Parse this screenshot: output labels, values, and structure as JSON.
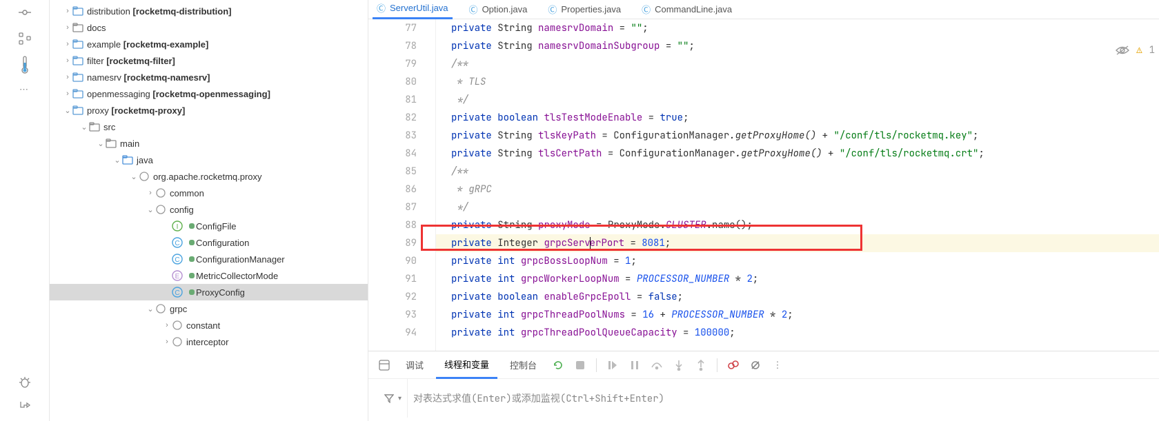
{
  "tree": {
    "n0": "distribution",
    "n0b": "[rocketmq-distribution]",
    "n1": "docs",
    "n2": "example",
    "n2b": "[rocketmq-example]",
    "n3": "filter",
    "n3b": "[rocketmq-filter]",
    "n4": "namesrv",
    "n4b": "[rocketmq-namesrv]",
    "n5": "openmessaging",
    "n5b": "[rocketmq-openmessaging]",
    "n6": "proxy",
    "n6b": "[rocketmq-proxy]",
    "n7": "src",
    "n8": "main",
    "n9": "java",
    "n10": "org.apache.rocketmq.proxy",
    "n11": "common",
    "n12": "config",
    "n13": "ConfigFile",
    "n14": "Configuration",
    "n15": "ConfigurationManager",
    "n16": "MetricCollectorMode",
    "n17": "ProxyConfig",
    "n18": "grpc",
    "n19": "constant",
    "n20": "interceptor"
  },
  "tabs": {
    "t0": "ServerUtil.java",
    "t1": "Option.java",
    "t2": "Properties.java",
    "t3": "CommandLine.java"
  },
  "lines": {
    "n77": "77",
    "n78": "78",
    "n79": "79",
    "n80": "80",
    "n81": "81",
    "n82": "82",
    "n83": "83",
    "n84": "84",
    "n85": "85",
    "n86": "86",
    "n87": "87",
    "n88": "88",
    "n89": "89",
    "n90": "90",
    "n91": "91",
    "n92": "92",
    "n93": "93",
    "n94": "94"
  },
  "code": {
    "kw_private": "private",
    "t_string": "String",
    "t_integer": "Integer",
    "t_int": "int",
    "t_boolean": "boolean",
    "f_namesrvDomain": "namesrvDomain",
    "f_namesrvDomainSubgroup": "namesrvDomainSubgroup",
    "f_tlsTestModeEnable": "tlsTestModeEnable",
    "f_tlsKeyPath": "tlsKeyPath",
    "f_tlsCertPath": "tlsCertPath",
    "f_proxyMode": "proxyMode",
    "f_grpcServerPort_a": "grpcServ",
    "f_grpcServerPort_b": "erPort",
    "f_grpcBossLoopNum": "grpcBossLoopNum",
    "f_grpcWorkerLoopNum": "grpcWorkerLoopNum",
    "f_enableGrpcEpoll": "enableGrpcEpoll",
    "f_grpcThreadPoolNums": "grpcThreadPoolNums",
    "f_grpcThreadPoolQueueCapacity": "grpcThreadPoolQueueCapacity",
    "eq": " = ",
    "emptystr": "\"\"",
    "semi": ";",
    "cmt_open": "/**",
    "cmt_tls": " * TLS",
    "cmt_grpc": " * gRPC",
    "cmt_close": " */",
    "val_true": "true",
    "val_false": "false",
    "cfgmgr": "ConfigurationManager",
    "getProxyHome": ".getProxyHome()",
    "plus": " + ",
    "keypath": "\"/conf/tls/rocketmq.key\"",
    "crtpath": "\"/conf/tls/rocketmq.crt\"",
    "proxymode": "ProxyMode.",
    "cluster": "CLUSTER",
    "dotname": ".name()",
    "n_8081": "8081",
    "n_1": "1",
    "procnum": "PROCESSOR_NUMBER",
    "times2": " * ",
    "n_2": "2",
    "n_16": "16",
    "plus2": " + ",
    "n_100000": "100000"
  },
  "warn_count": "1",
  "debug": {
    "t_debug": "调试",
    "t_threads": "线程和变量",
    "t_console": "控制台",
    "placeholder": "对表达式求值(Enter)或添加监视(Ctrl+Shift+Enter)"
  }
}
